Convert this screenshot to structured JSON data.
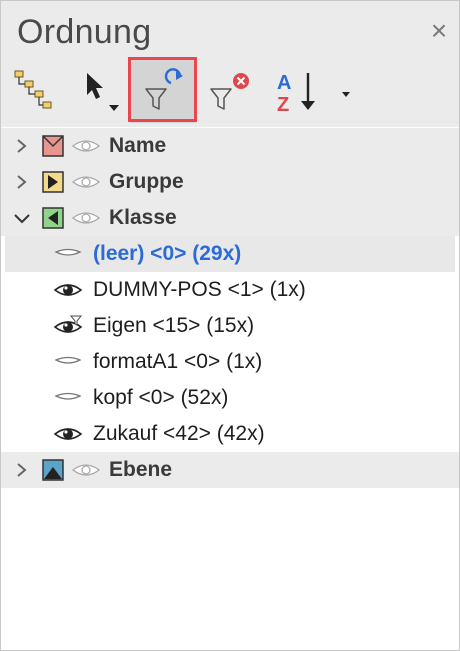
{
  "panel": {
    "title": "Ordnung",
    "close_glyph": "×"
  },
  "toolbar": {
    "buttons": [
      {
        "icon": "hierarchy-icon"
      },
      {
        "icon": "select-arrow-icon",
        "has_dropdown": true
      },
      {
        "icon": "refresh-filter-icon",
        "active": true,
        "highlighted": true
      },
      {
        "icon": "clear-filter-icon"
      },
      {
        "icon": "sort-az-icon",
        "text_a": "A",
        "text_z": "Z",
        "has_dropdown": true
      }
    ]
  },
  "tree": {
    "categories": [
      {
        "label": "Name",
        "expanded": false,
        "icon": "name-category-icon"
      },
      {
        "label": "Gruppe",
        "expanded": false,
        "icon": "gruppe-category-icon"
      },
      {
        "label": "Klasse",
        "expanded": true,
        "icon": "klasse-category-icon"
      },
      {
        "label": "Ebene",
        "expanded": false,
        "icon": "ebene-category-icon"
      }
    ],
    "klasse_items": [
      {
        "label": "(leer) <0> (29x)",
        "visibility": "hidden",
        "selected": true
      },
      {
        "label": "DUMMY-POS <1> (1x)",
        "visibility": "visible"
      },
      {
        "label": "Eigen <15> (15x)",
        "visibility": "visible-filtered"
      },
      {
        "label": "formatA1 <0> (1x)",
        "visibility": "hidden"
      },
      {
        "label": "kopf <0> (52x)",
        "visibility": "hidden"
      },
      {
        "label": "Zukauf <42> (42x)",
        "visibility": "visible"
      }
    ]
  },
  "colors": {
    "selected_text": "#2a6bd6",
    "highlight_border": "#e8474f",
    "arrow_blue": "#2a6bd6",
    "clear_red": "#e0474c"
  }
}
